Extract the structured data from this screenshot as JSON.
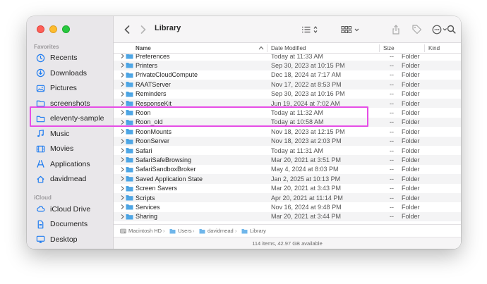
{
  "window": {
    "title": "Library"
  },
  "sidebar": {
    "favorites_label": "Favorites",
    "icloud_label": "iCloud",
    "favorites": [
      {
        "label": "Recents",
        "icon": "clock-icon"
      },
      {
        "label": "Downloads",
        "icon": "download-icon"
      },
      {
        "label": "Pictures",
        "icon": "pictures-icon"
      },
      {
        "label": "screenshots",
        "icon": "folder-icon"
      },
      {
        "label": "eleventy-sample",
        "icon": "folder-icon"
      },
      {
        "label": "Music",
        "icon": "music-icon"
      },
      {
        "label": "Movies",
        "icon": "movies-icon"
      },
      {
        "label": "Applications",
        "icon": "applications-icon"
      },
      {
        "label": "davidmead",
        "icon": "home-icon"
      }
    ],
    "icloud": [
      {
        "label": "iCloud Drive",
        "icon": "cloud-icon"
      },
      {
        "label": "Documents",
        "icon": "document-icon"
      },
      {
        "label": "Desktop",
        "icon": "desktop-icon"
      }
    ]
  },
  "columns": {
    "name": "Name",
    "date": "Date Modified",
    "size": "Size",
    "kind": "Kind"
  },
  "rows": [
    {
      "name": "Preferences",
      "date": "Today at 11:33 AM",
      "size": "--",
      "kind": "Folder"
    },
    {
      "name": "Printers",
      "date": "Sep 30, 2023 at 10:15 PM",
      "size": "--",
      "kind": "Folder"
    },
    {
      "name": "PrivateCloudCompute",
      "date": "Dec 18, 2024 at 7:17 AM",
      "size": "--",
      "kind": "Folder"
    },
    {
      "name": "RAATServer",
      "date": "Nov 17, 2022 at 8:53 PM",
      "size": "--",
      "kind": "Folder"
    },
    {
      "name": "Reminders",
      "date": "Sep 30, 2023 at 10:16 PM",
      "size": "--",
      "kind": "Folder"
    },
    {
      "name": "ResponseKit",
      "date": "Jun 19, 2024 at 7:02 AM",
      "size": "--",
      "kind": "Folder"
    },
    {
      "name": "Roon",
      "date": "Today at 11:32 AM",
      "size": "--",
      "kind": "Folder"
    },
    {
      "name": "Roon_old",
      "date": "Today at 10:58 AM",
      "size": "--",
      "kind": "Folder"
    },
    {
      "name": "RoonMounts",
      "date": "Nov 18, 2023 at 12:15 PM",
      "size": "--",
      "kind": "Folder"
    },
    {
      "name": "RoonServer",
      "date": "Nov 18, 2023 at 2:03 PM",
      "size": "--",
      "kind": "Folder"
    },
    {
      "name": "Safari",
      "date": "Today at 11:31 AM",
      "size": "--",
      "kind": "Folder"
    },
    {
      "name": "SafariSafeBrowsing",
      "date": "Mar 20, 2021 at 3:51 PM",
      "size": "--",
      "kind": "Folder"
    },
    {
      "name": "SafariSandboxBroker",
      "date": "May 4, 2024 at 8:03 PM",
      "size": "--",
      "kind": "Folder"
    },
    {
      "name": "Saved Application State",
      "date": "Jan 2, 2025 at 10:13 PM",
      "size": "--",
      "kind": "Folder"
    },
    {
      "name": "Screen Savers",
      "date": "Mar 20, 2021 at 3:43 PM",
      "size": "--",
      "kind": "Folder"
    },
    {
      "name": "Scripts",
      "date": "Apr 20, 2021 at 11:14 PM",
      "size": "--",
      "kind": "Folder"
    },
    {
      "name": "Services",
      "date": "Nov 16, 2024 at 9:48 PM",
      "size": "--",
      "kind": "Folder"
    },
    {
      "name": "Sharing",
      "date": "Mar 20, 2021 at 3:44 PM",
      "size": "--",
      "kind": "Folder"
    }
  ],
  "pathbar": {
    "items": [
      "Macintosh HD",
      "Users",
      "davidmead",
      "Library"
    ]
  },
  "status": {
    "text": "114 items, 42.97 GB available"
  },
  "colors": {
    "folder": "#4fa7e6",
    "sidebar_icon": "#1f7cf0",
    "highlight": "#e64ee6"
  }
}
